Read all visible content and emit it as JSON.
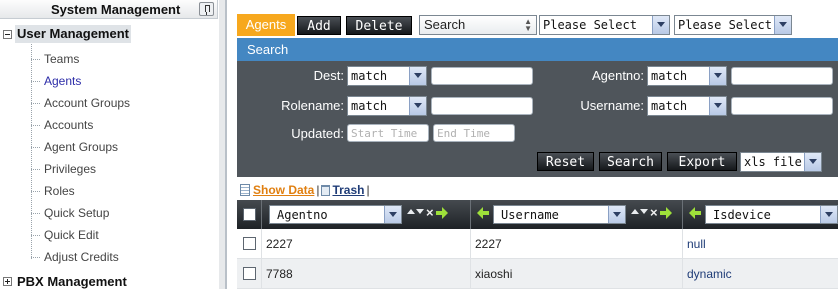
{
  "sidebar": {
    "title": "System Management",
    "groups": [
      {
        "label": "User Management",
        "expanded": true,
        "items": [
          {
            "label": "Teams"
          },
          {
            "label": "Agents"
          },
          {
            "label": "Account Groups"
          },
          {
            "label": "Accounts"
          },
          {
            "label": "Agent Groups"
          },
          {
            "label": "Privileges"
          },
          {
            "label": "Roles"
          },
          {
            "label": "Quick Setup"
          },
          {
            "label": "Quick Edit"
          },
          {
            "label": "Adjust Credits"
          }
        ]
      },
      {
        "label": "PBX Management",
        "expanded": false
      }
    ]
  },
  "toolbar": {
    "active_tab": "Agents",
    "add_label": "Add",
    "delete_label": "Delete",
    "search_combo": "Search",
    "select_1": "Please Select",
    "select_2": "Please Select"
  },
  "search_panel": {
    "title": "Search",
    "fields": {
      "dest": {
        "label": "Dest:",
        "operator": "match",
        "value": ""
      },
      "agentno": {
        "label": "Agentno:",
        "operator": "match",
        "value": ""
      },
      "rolename": {
        "label": "Rolename:",
        "operator": "match",
        "value": ""
      },
      "username": {
        "label": "Username:",
        "operator": "match",
        "value": ""
      },
      "updated": {
        "label": "Updated:",
        "start_placeholder": "Start Time",
        "end_placeholder": "End Time"
      }
    },
    "reset_label": "Reset",
    "search_label": "Search",
    "export_label": "Export",
    "export_format": "xls file"
  },
  "links": {
    "show_data": "Show Data",
    "trash": "Trash",
    "separator": "|"
  },
  "grid": {
    "columns": [
      {
        "label": "Agentno"
      },
      {
        "label": "Username"
      },
      {
        "label": "Isdevice"
      }
    ],
    "rows": [
      {
        "agentno": "2227",
        "username": "2227",
        "isdevice": "null"
      },
      {
        "agentno": "7788",
        "username": "xiaoshi",
        "isdevice": "dynamic"
      }
    ]
  },
  "colors": {
    "active_tab": "#f7a81e",
    "panel_title": "#4487c2",
    "panel_bg": "#4f555b",
    "link_show": "#e07f10",
    "link_trash": "#1f3c77",
    "arrow": "#9ee03a"
  }
}
